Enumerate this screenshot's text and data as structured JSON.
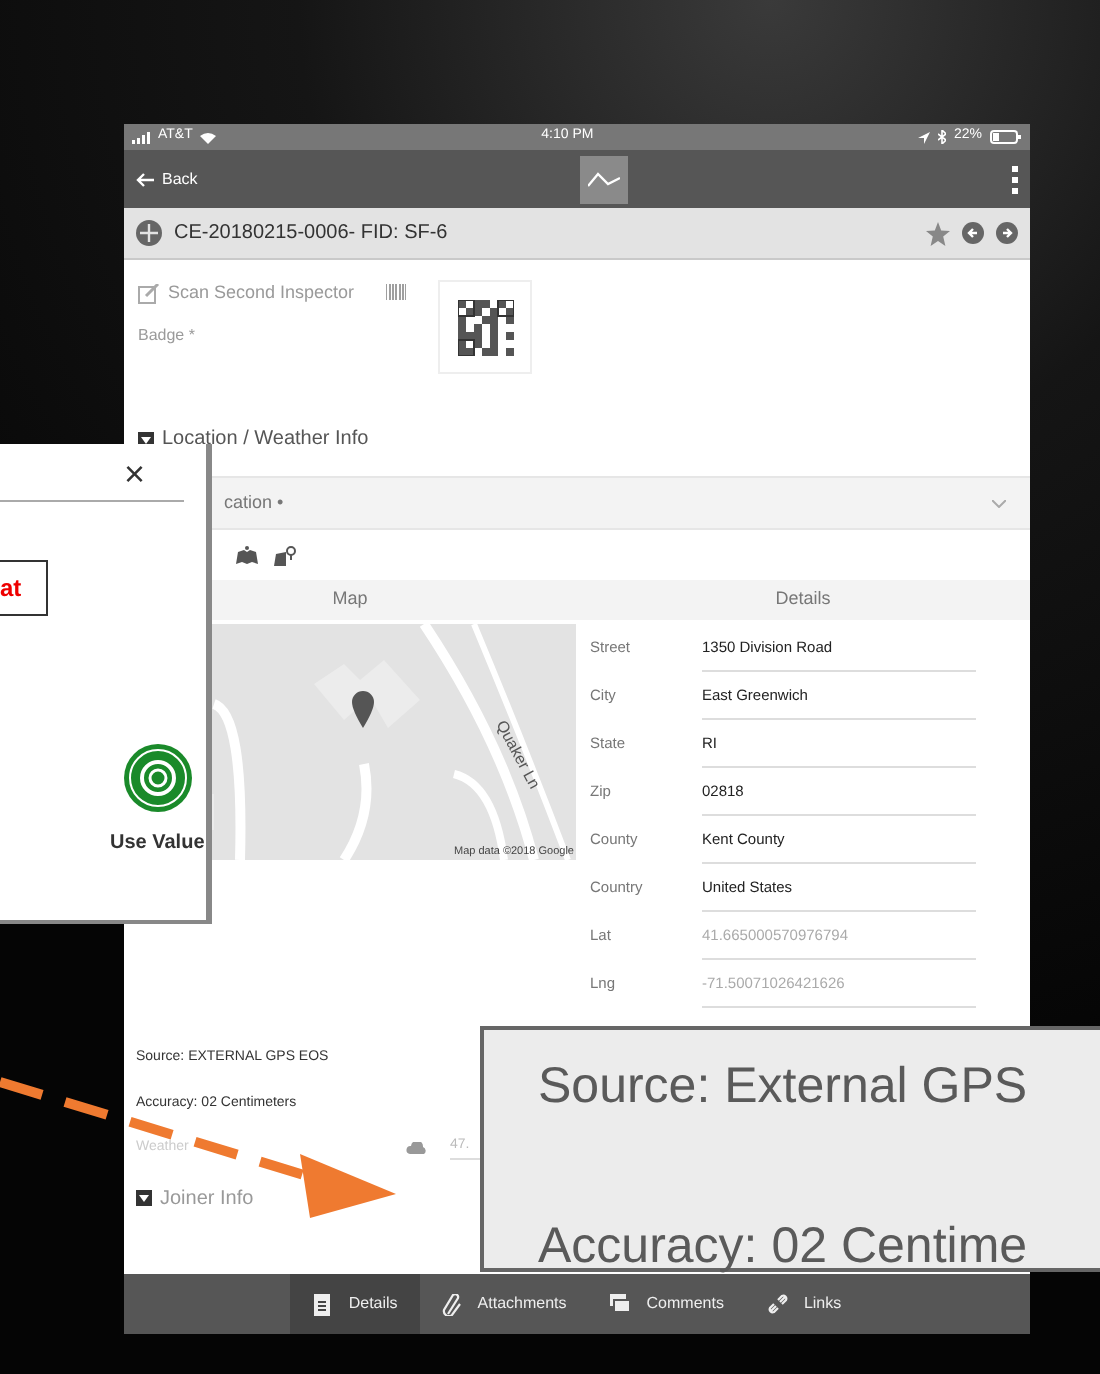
{
  "status_bar": {
    "carrier": "AT&T",
    "time": "4:10 PM",
    "battery": "22%"
  },
  "nav_bar": {
    "back": "Back"
  },
  "record": {
    "title": "CE-20180215-0006- FID: SF-6"
  },
  "form": {
    "scan_label": "Scan Second Inspector",
    "badge_label": "Badge *",
    "section_title": "Location / Weather Info",
    "location_header": "cation •",
    "map_header": "Map",
    "details_header": "Details",
    "map": {
      "street_name": "Quaker Ln",
      "attribution": "Map data ©2018 Google"
    },
    "details": [
      {
        "label": "Street",
        "value": "1350  Division Road",
        "kind": "value"
      },
      {
        "label": "City",
        "value": "East Greenwich",
        "kind": "value"
      },
      {
        "label": "State",
        "value": "RI",
        "kind": "value"
      },
      {
        "label": "Zip",
        "value": "02818",
        "kind": "value"
      },
      {
        "label": "County",
        "value": "Kent County",
        "kind": "value"
      },
      {
        "label": "Country",
        "value": "United States",
        "kind": "value"
      },
      {
        "label": "Lat",
        "value": "41.665000570976794",
        "kind": "readonly"
      },
      {
        "label": "Lng",
        "value": "-71.50071026421626",
        "kind": "readonly"
      }
    ],
    "source": "Source: EXTERNAL GPS EOS",
    "accuracy": "Accuracy: 02 Centimeters",
    "weather": {
      "label": "Weather",
      "value": "47."
    },
    "joiner_title": "Joiner  Info"
  },
  "tabs": [
    {
      "label": "Details",
      "selected": true
    },
    {
      "label": "Attachments",
      "selected": false
    },
    {
      "label": "Comments",
      "selected": false
    },
    {
      "label": "Links",
      "selected": false
    }
  ],
  "popup": {
    "close": "×",
    "value_text": "at",
    "action": "Use Value"
  },
  "callout": {
    "lines": [
      "Source: External GPS",
      "Accuracy: 02 Centime"
    ]
  }
}
